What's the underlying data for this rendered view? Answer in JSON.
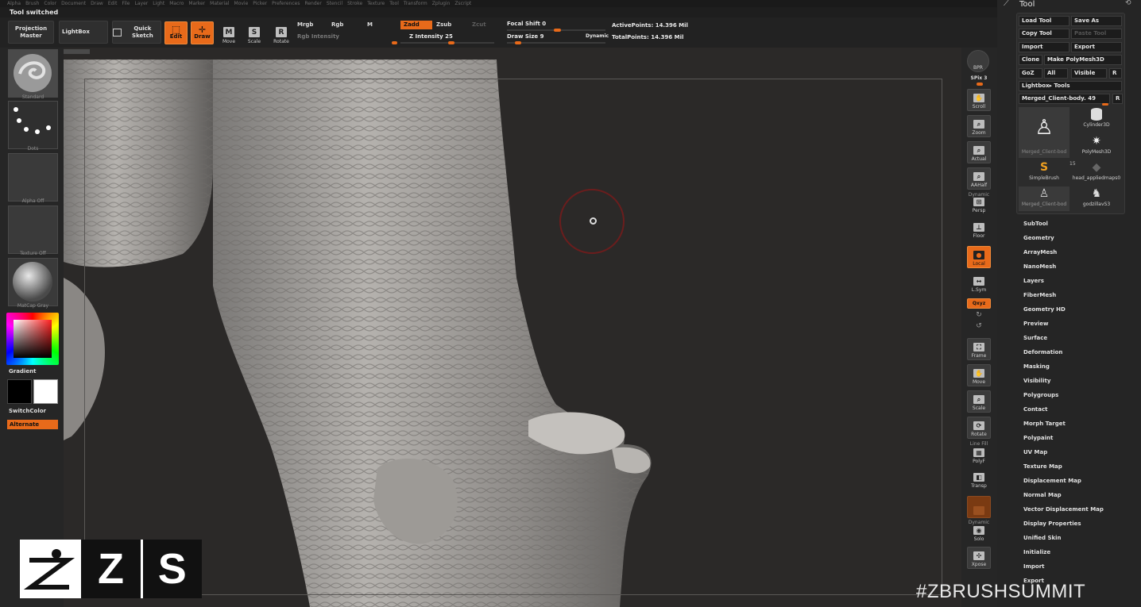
{
  "menu": [
    "Alpha",
    "Brush",
    "Color",
    "Document",
    "Draw",
    "Edit",
    "File",
    "Layer",
    "Light",
    "Macro",
    "Marker",
    "Material",
    "Movie",
    "Picker",
    "Preferences",
    "Render",
    "Stencil",
    "Stroke",
    "Texture",
    "Tool",
    "Transform",
    "Zplugin",
    "Zscript"
  ],
  "status": "Tool switched",
  "toolbar": {
    "projection_master": "Projection Master",
    "lightbox": "LightBox",
    "quick_sketch": "Quick Sketch",
    "edit": "Edit",
    "draw": "Draw",
    "move": "Move",
    "scale": "Scale",
    "rotate": "Rotate",
    "mrgb": "Mrgb",
    "rgb": "Rgb",
    "m": "M",
    "rgb_intensity": "Rgb Intensity",
    "zadd": "Zadd",
    "zsub": "Zsub",
    "zcut": "Zcut",
    "z_intensity": "Z Intensity 25",
    "focal_shift": "Focal Shift 0",
    "draw_size": "Draw Size 9",
    "dynamic": "Dynamic",
    "active_points": "ActivePoints: 14.396 Mil",
    "total_points": "TotalPoints: 14.396 Mil"
  },
  "left": {
    "brush": "Standard",
    "stroke": "Dots",
    "alpha": "Alpha Off",
    "texture": "Texture Off",
    "material": "MatCap Gray",
    "gradient": "Gradient",
    "switch_color": "SwitchColor",
    "alternate": "Alternate",
    "colors": {
      "primary": "#000000",
      "secondary": "#ffffff"
    }
  },
  "right": {
    "bpr": "BPR",
    "spix": "SPix 3",
    "scroll": "Scroll",
    "zoom": "Zoom",
    "actual": "Actual",
    "aahalf": "AAHalf",
    "dynamic": "Dynamic",
    "persp": "Persp",
    "floor": "Floor",
    "local": "Local",
    "lsym": "L.Sym",
    "xyz": "Qxyz",
    "frame": "Frame",
    "move": "Move",
    "scale": "Scale",
    "rotate": "Rotate",
    "line_fill": "Line Fill",
    "polyf": "PolyF",
    "transp": "Transp",
    "dynamic2": "Dynamic",
    "solo": "Solo",
    "xpose": "Xpose"
  },
  "palette": {
    "title": "Tool",
    "load_tool": "Load Tool",
    "save_as": "Save As",
    "copy_tool": "Copy Tool",
    "paste_tool": "Paste Tool",
    "import": "Import",
    "export": "Export",
    "clone": "Clone",
    "make_polymesh": "Make PolyMesh3D",
    "goz": "GoZ",
    "all": "All",
    "visible": "Visible",
    "r": "R",
    "lightbox_tools": "Lightbox▸ Tools",
    "current_tool": "Merged_Client-body. 49",
    "tools": [
      "Merged_Client-bod",
      "Cylinder3D",
      "PolyMesh3D",
      "SimpleBrush",
      "head_appliedmaps0",
      "Merged_Client-bod",
      "godzillavS3"
    ],
    "tools_count": "15",
    "submenus": [
      "SubTool",
      "Geometry",
      "ArrayMesh",
      "NanoMesh",
      "Layers",
      "FiberMesh",
      "Geometry HD",
      "Preview",
      "Surface",
      "Deformation",
      "Masking",
      "Visibility",
      "Polygroups",
      "Contact",
      "Morph Target",
      "Polypaint",
      "UV Map",
      "Texture Map",
      "Displacement Map",
      "Normal Map",
      "Vector Displacement Map",
      "Display Properties",
      "Unified Skin",
      "Initialize",
      "Import",
      "Export"
    ]
  },
  "watermark": {
    "logo_letters": [
      "Z",
      "S"
    ],
    "hashtag": "#ZBRUSHSUMMIT"
  },
  "accent": "#e86a1a"
}
